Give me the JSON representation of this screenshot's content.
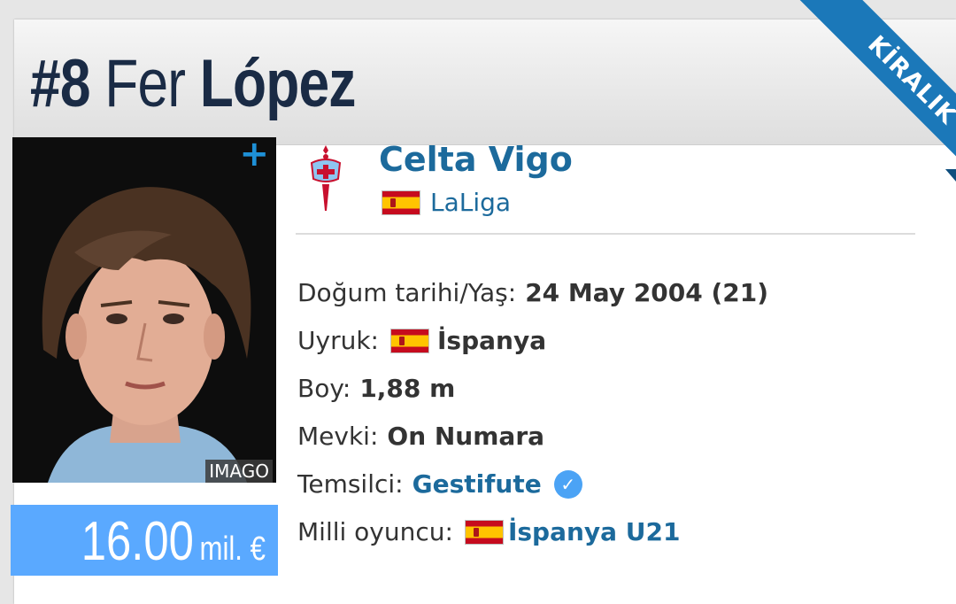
{
  "player": {
    "number": "#8",
    "first_name": "Fer",
    "last_name": "López",
    "status_ribbon": "KİRALIK",
    "photo_credit": "IMAGO",
    "photo_expand": "+",
    "market_value": {
      "amount": "16.00",
      "unit": "mil. €"
    }
  },
  "club": {
    "name": "Celta Vigo",
    "league": "LaLiga",
    "league_country_flag": "spain-flag"
  },
  "info": {
    "dob": {
      "label": "Doğum tarihi/Yaş:",
      "value": "24 May 2004 (21)"
    },
    "citizenship": {
      "label": "Uyruk:",
      "value": "İspanya",
      "flag": "spain-flag"
    },
    "height": {
      "label": "Boy:",
      "value": "1,88 m"
    },
    "position": {
      "label": "Mevki:",
      "value": "On Numara"
    },
    "agent": {
      "label": "Temsilci:",
      "value": "Gestifute",
      "icon": "verified-check-icon"
    },
    "national": {
      "label": "Milli oyuncu:",
      "value": "İspanya U21",
      "flag": "spain-flag"
    }
  },
  "colors": {
    "accent": "#1c6a9c",
    "ribbon": "#1b78b9",
    "value_box": "#5aa9ff",
    "title": "#1a2b45",
    "verified": "#4ba3f5"
  }
}
